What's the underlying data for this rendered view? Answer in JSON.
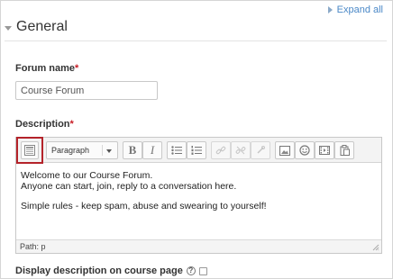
{
  "header": {
    "expand_all": "Expand all",
    "section_title": "General"
  },
  "forum_name": {
    "label": "Forum name",
    "required_mark": "*",
    "value": "Course Forum"
  },
  "description": {
    "label": "Description",
    "required_mark": "*",
    "toolbar": {
      "format_select_value": "Paragraph",
      "bold_label": "B",
      "italic_label": "I"
    },
    "content_lines": [
      "Welcome to our Course Forum.",
      "Anyone can start, join, reply to a conversation here.",
      "Simple rules - keep spam, abuse and swearing to yourself!"
    ],
    "path": "Path: p"
  },
  "display_on_course_page": {
    "label": "Display description on course page",
    "help_glyph": "?"
  },
  "icons": {
    "toggle_toolbar": "toggle-toolbar-icon",
    "bullet_list": "bullet-list-icon",
    "numbered_list": "numbered-list-icon",
    "link": "link-icon",
    "unlink": "unlink-icon",
    "anchor": "anchor-icon",
    "image": "image-icon",
    "emoticon": "emoticon-icon",
    "media": "media-icon",
    "paste": "paste-icon"
  },
  "colors": {
    "required": "#c81d25",
    "link": "#4a88c7",
    "highlight": "#b4232a"
  }
}
